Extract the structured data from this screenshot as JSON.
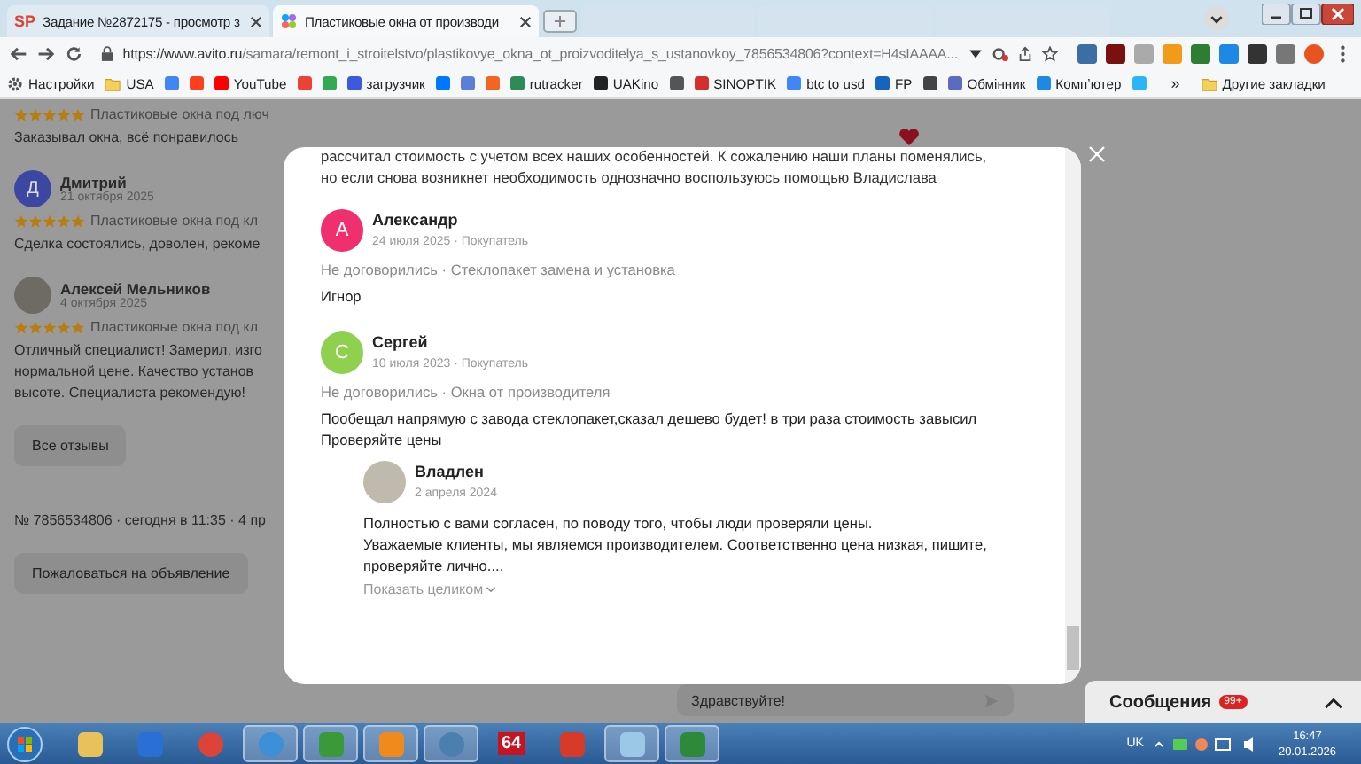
{
  "browser": {
    "tabs": [
      {
        "kind": "text_favicon",
        "favicon": "SP",
        "title": "Задание №2872175 - просмотр з",
        "selected": false
      },
      {
        "kind": "icon_favicon",
        "title": "Пластиковые окна от производи",
        "selected": true
      },
      {
        "kind": "blurred"
      },
      {
        "kind": "blurred"
      },
      {
        "kind": "blurred"
      }
    ],
    "address": {
      "host": "https://www.avito.ru",
      "path": "/samara/remont_i_stroitelstvo/plastikovye_okna_ot_proizvoditelya_s_ustanovkoy_7856534806?context=H4sIAAAA..."
    },
    "bookmarks": [
      {
        "kind": "gear",
        "label": "Настройки"
      },
      {
        "kind": "folder",
        "label": "USA"
      },
      {
        "kind": "site",
        "color": "#4285f4"
      },
      {
        "kind": "site",
        "color": "#fc3f1d"
      },
      {
        "kind": "site",
        "color": "#ff0000",
        "label": "YouTube"
      },
      {
        "kind": "site",
        "color": "#ea4335"
      },
      {
        "kind": "site",
        "color": "#34a853"
      },
      {
        "kind": "site",
        "color": "#3b5bdb",
        "label": "загрузчик"
      },
      {
        "kind": "site",
        "color": "#0077ff"
      },
      {
        "kind": "site",
        "color": "#5b7fd6"
      },
      {
        "kind": "site",
        "color": "#f26522"
      },
      {
        "kind": "site",
        "color": "#2e8b57",
        "label": "rutracker"
      },
      {
        "kind": "site",
        "color": "#222222",
        "label": "UAKino"
      },
      {
        "kind": "site",
        "color": "#555555"
      },
      {
        "kind": "site",
        "color": "#d32f2f",
        "label": "SINOPTIK"
      },
      {
        "kind": "site",
        "color": "#4285f4",
        "label": "btc to usd"
      },
      {
        "kind": "site",
        "color": "#1565c0",
        "label": "FP"
      },
      {
        "kind": "site",
        "color": "#444444"
      },
      {
        "kind": "site",
        "color": "#5c6bc0",
        "label": "Обмінник"
      },
      {
        "kind": "site",
        "color": "#1e88e5",
        "label": "Компʼютер"
      },
      {
        "kind": "site",
        "color": "#29b6f6"
      }
    ],
    "more_bookmarks": "»",
    "other_bookmarks": "Другие закладки"
  },
  "page": {
    "reviews": [
      {
        "kind": "plain",
        "stars": 5,
        "product": "Пластиковые окна под люч",
        "text": "Заказывал окна, всё понравилось"
      },
      {
        "kind": "letter",
        "letter": "Д",
        "author": "Дмитрий",
        "date": "21 октября 2025",
        "stars": 5,
        "product": "Пластиковые окна под кл",
        "text": "Сделка состоялись, доволен, рекоме"
      },
      {
        "kind": "photo",
        "author": "Алексей Мельников",
        "date": "4 октября 2025",
        "stars": 5,
        "product": "Пластиковые окна под кл",
        "text": "Отличный специалист! Замерил, изго\nнормальной цене. Качество установ\nвысоте. Специалиста рекомендую!"
      }
    ],
    "all_reviews_button": "Все отзывы",
    "listing_meta": "№ 7856534806 · сегодня в 11:35 · 4 пр",
    "report_button": "Пожаловаться на объявление",
    "chat_field": {
      "value": "Здравствуйте!"
    },
    "messages_panel": {
      "title": "Сообщения",
      "badge": "99+"
    }
  },
  "modal": {
    "intro_text": "рассчитал стоимость с учетом всех наших особенностей. К сожалению наши планы поменялись,\nно если снова возникнет необходимость однозначно воспользуюсь помощью Владислава",
    "reviews": [
      {
        "author": "Александр",
        "letter": "А",
        "color": "#f0306e",
        "date": "24 июля 2025 · Покупатель",
        "deal": "Не договорились · Стеклопакет замена и установка",
        "text": "Игнор"
      },
      {
        "author": "Сергей",
        "letter": "С",
        "color": "#8fd14f",
        "date": "10 июля 2023 · Покупатель",
        "deal": "Не договорились · Окна от производителя",
        "text": "Пообещал напрямую с завода стеклопакет,сказал дешево будет! в три раза стоимость завысил\nПроверяйте цены",
        "reply": {
          "author": "Владлен",
          "date": "2 апреля 2024",
          "text": "Полностью с вами согласен, по поводу того, чтобы люди проверяли цены.\nУважаемые клиенты, мы являемся производителем. Соответственно цена низкая, пишите,\nпроверяйте лично....",
          "more": "Показать целиком"
        }
      }
    ]
  },
  "taskbar": {
    "items": [
      {
        "kind": "app",
        "color": "#e8c15a",
        "selected": false
      },
      {
        "kind": "app",
        "color": "#2a6fd6",
        "selected": false
      },
      {
        "kind": "round",
        "color": "#db4437",
        "selected": false
      },
      {
        "kind": "round",
        "color": "#3d8fd8",
        "selected": true
      },
      {
        "kind": "app",
        "color": "#3a9a3a",
        "selected": true
      },
      {
        "kind": "app",
        "color": "#f08a1c",
        "selected": true
      },
      {
        "kind": "round",
        "color": "#4a7fb0",
        "selected": true
      },
      {
        "kind": "text",
        "label": "64",
        "color": "#c8141e",
        "selected": false
      },
      {
        "kind": "app",
        "color": "#d83a2a",
        "selected": false
      },
      {
        "kind": "app",
        "color": "#9cc8e8",
        "selected": true
      },
      {
        "kind": "app",
        "color": "#2d8a3a",
        "selected": true
      }
    ],
    "language": "UK",
    "time": "16:47",
    "date": "20.01.2026"
  }
}
